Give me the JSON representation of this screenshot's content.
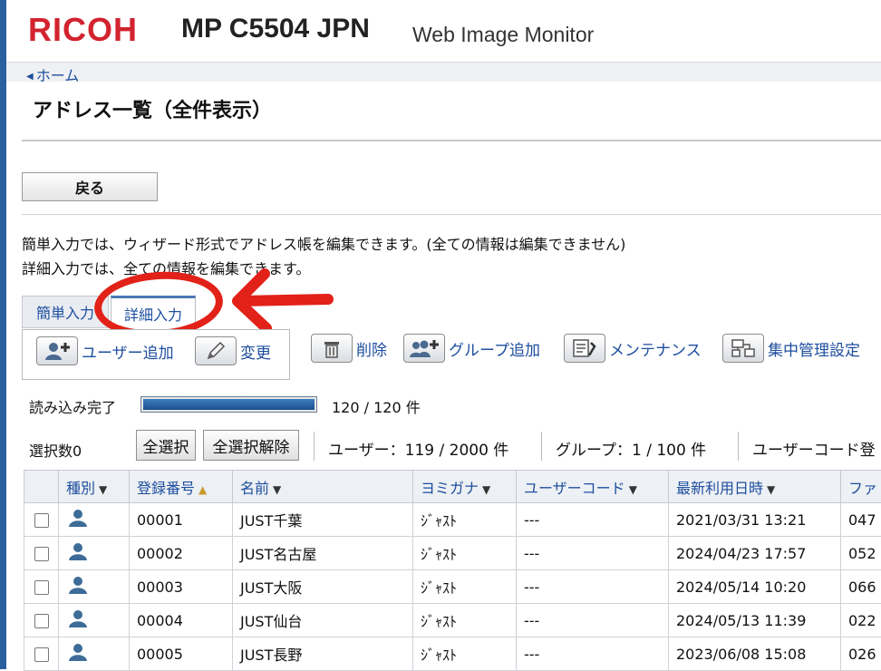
{
  "header": {
    "logo": "RICOH",
    "model": "MP C5504 JPN",
    "app_name": "Web Image Monitor"
  },
  "nav": {
    "home": "ホーム"
  },
  "page": {
    "title": "アドレス一覧（全件表示）",
    "back_button": "戻る",
    "desc_line1": "簡単入力では、ウィザード形式でアドレス帳を編集できます。(全ての情報は編集できません)",
    "desc_line2": "詳細入力では、全ての情報を編集できます。"
  },
  "tabs": [
    {
      "label": "簡単入力",
      "active": false
    },
    {
      "label": "詳細入力",
      "active": true
    }
  ],
  "annotation": {
    "color": "#e22119"
  },
  "toolbar": {
    "add_user": "ユーザー追加",
    "change": "変更",
    "delete": "削除",
    "add_group": "グループ追加",
    "maintenance": "メンテナンス",
    "central_mgmt": "集中管理設定"
  },
  "loading": {
    "label": "読み込み完了",
    "progress": 1.0,
    "count_text": "120 / 120 件"
  },
  "selection": {
    "count_text": "選択数0",
    "select_all": "全選択",
    "deselect_all": "全選択解除",
    "users_stat": "ユーザー：119 / 2000 件",
    "groups_stat": "グループ：1 / 100 件",
    "usercode_stat": "ユーザーコード登"
  },
  "table": {
    "columns": [
      "種別",
      "登録番号",
      "名前",
      "ヨミガナ",
      "ユーザーコード",
      "最新利用日時",
      "ファ"
    ],
    "rows": [
      {
        "number": "00001",
        "name": "JUST千葉",
        "kana": "ｼﾞｬｽﾄ",
        "usercode": "---",
        "last_used": "2021/03/31 13:21",
        "fax": "047"
      },
      {
        "number": "00002",
        "name": "JUST名古屋",
        "kana": "ｼﾞｬｽﾄ",
        "usercode": "---",
        "last_used": "2024/04/23 17:57",
        "fax": "052"
      },
      {
        "number": "00003",
        "name": "JUST大阪",
        "kana": "ｼﾞｬｽﾄ",
        "usercode": "---",
        "last_used": "2024/05/14 10:20",
        "fax": "066"
      },
      {
        "number": "00004",
        "name": "JUST仙台",
        "kana": "ｼﾞｬｽﾄ",
        "usercode": "---",
        "last_used": "2024/05/13 11:39",
        "fax": "022"
      },
      {
        "number": "00005",
        "name": "JUST長野",
        "kana": "ｼﾞｬｽﾄ",
        "usercode": "---",
        "last_used": "2023/06/08 15:08",
        "fax": "026"
      }
    ]
  }
}
